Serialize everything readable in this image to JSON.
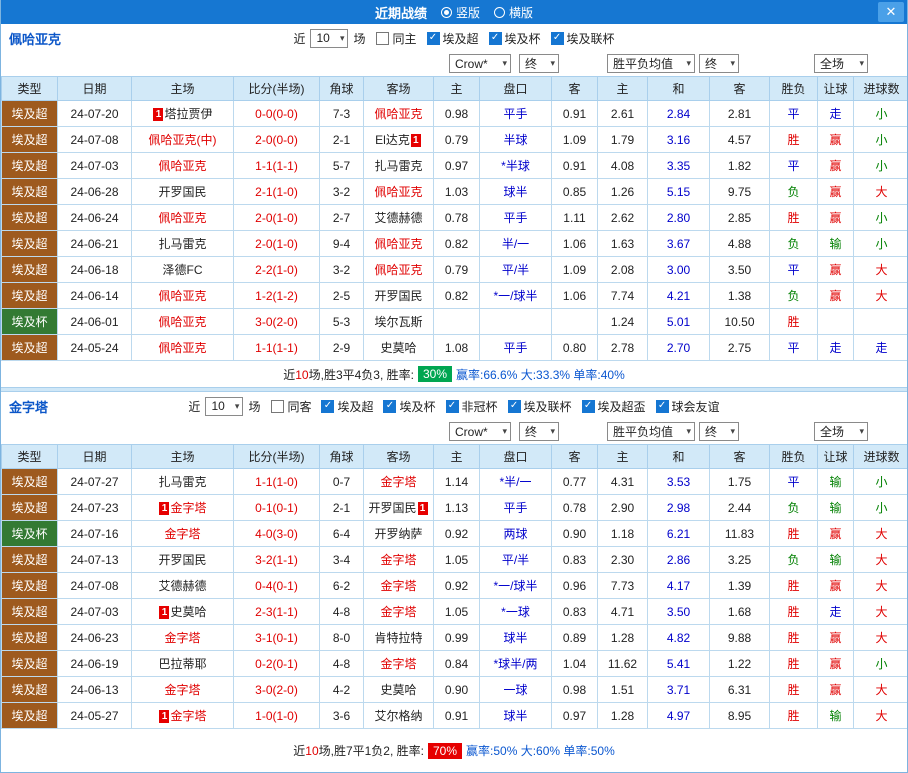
{
  "titlebar": {
    "title": "近期战绩",
    "radio_vertical": "竖版",
    "radio_horizontal": "横版"
  },
  "icons": {
    "close": "✕",
    "check": "✓",
    "dropdown": "▾"
  },
  "badge_char": "1",
  "columns": [
    "类型",
    "日期",
    "主场",
    "比分(半场)",
    "角球",
    "客场",
    "主",
    "盘口",
    "客",
    "主",
    "和",
    "客",
    "胜负",
    "让球",
    "进球数"
  ],
  "colors": {
    "titlebar_bg": "#1677d2",
    "super_bg": "#9e5a1e",
    "cup_bg": "#337a33",
    "red": "#e00000",
    "green": "#008000",
    "blue": "#0000cc",
    "rate_green_bg": "#00a651",
    "rate_red_bg": "#e60000",
    "value_map": {
      "胜": "red",
      "赢": "red",
      "大": "red",
      "负": "green",
      "输": "green",
      "小": "green",
      "平": "blue",
      "走": "blue"
    }
  },
  "section1": {
    "team": "佩哈亚克",
    "filters": {
      "near": "近",
      "count": "10",
      "games": "场",
      "checkboxes": [
        {
          "label": "同主",
          "checked": false
        },
        {
          "label": "埃及超",
          "checked": true
        },
        {
          "label": "埃及杯",
          "checked": true
        },
        {
          "label": "埃及联杯",
          "checked": true
        }
      ]
    },
    "selects": {
      "book": "Crow*",
      "t1": "终",
      "avg": "胜平负均值",
      "t2": "终",
      "scope": "全场"
    },
    "rows": [
      {
        "type": "埃及超",
        "league": "super",
        "date": "24-07-20",
        "home": "塔拉贾伊",
        "home_focal": false,
        "home_badge": "pre",
        "score": "0-0(0-0)",
        "corner": "7-3",
        "away": "佩哈亚克",
        "away_focal": true,
        "away_badge": "",
        "odds_h": "0.98",
        "handicap": "平手",
        "odds_a": "0.91",
        "eu_h": "2.61",
        "eu_d": "2.84",
        "eu_a": "2.81",
        "result": "平",
        "let_result": "走",
        "goal_result": "小"
      },
      {
        "type": "埃及超",
        "league": "super",
        "date": "24-07-08",
        "home": "佩哈亚克(中)",
        "home_focal": true,
        "home_badge": "",
        "score": "2-0(0-0)",
        "corner": "2-1",
        "away": "El达克",
        "away_focal": false,
        "away_badge": "post",
        "odds_h": "0.79",
        "handicap": "半球",
        "odds_a": "1.09",
        "eu_h": "1.79",
        "eu_d": "3.16",
        "eu_a": "4.57",
        "result": "胜",
        "let_result": "赢",
        "goal_result": "小"
      },
      {
        "type": "埃及超",
        "league": "super",
        "date": "24-07-03",
        "home": "佩哈亚克",
        "home_focal": true,
        "home_badge": "",
        "score": "1-1(1-1)",
        "corner": "5-7",
        "away": "扎马雷克",
        "away_focal": false,
        "away_badge": "",
        "odds_h": "0.97",
        "handicap": "*半球",
        "odds_a": "0.91",
        "eu_h": "4.08",
        "eu_d": "3.35",
        "eu_a": "1.82",
        "result": "平",
        "let_result": "赢",
        "goal_result": "小"
      },
      {
        "type": "埃及超",
        "league": "super",
        "date": "24-06-28",
        "home": "开罗国民",
        "home_focal": false,
        "home_badge": "",
        "score": "2-1(1-0)",
        "corner": "3-2",
        "away": "佩哈亚克",
        "away_focal": true,
        "away_badge": "",
        "odds_h": "1.03",
        "handicap": "球半",
        "odds_a": "0.85",
        "eu_h": "1.26",
        "eu_d": "5.15",
        "eu_a": "9.75",
        "result": "负",
        "let_result": "赢",
        "goal_result": "大"
      },
      {
        "type": "埃及超",
        "league": "super",
        "date": "24-06-24",
        "home": "佩哈亚克",
        "home_focal": true,
        "home_badge": "",
        "score": "2-0(1-0)",
        "corner": "2-7",
        "away": "艾德赫德",
        "away_focal": false,
        "away_badge": "",
        "odds_h": "0.78",
        "handicap": "平手",
        "odds_a": "1.11",
        "eu_h": "2.62",
        "eu_d": "2.80",
        "eu_a": "2.85",
        "result": "胜",
        "let_result": "赢",
        "goal_result": "小"
      },
      {
        "type": "埃及超",
        "league": "super",
        "date": "24-06-21",
        "home": "扎马雷克",
        "home_focal": false,
        "home_badge": "",
        "score": "2-0(1-0)",
        "corner": "9-4",
        "away": "佩哈亚克",
        "away_focal": true,
        "away_badge": "",
        "odds_h": "0.82",
        "handicap": "半/一",
        "odds_a": "1.06",
        "eu_h": "1.63",
        "eu_d": "3.67",
        "eu_a": "4.88",
        "result": "负",
        "let_result": "输",
        "goal_result": "小"
      },
      {
        "type": "埃及超",
        "league": "super",
        "date": "24-06-18",
        "home": "泽德FC",
        "home_focal": false,
        "home_badge": "",
        "score": "2-2(1-0)",
        "corner": "3-2",
        "away": "佩哈亚克",
        "away_focal": true,
        "away_badge": "",
        "odds_h": "0.79",
        "handicap": "平/半",
        "odds_a": "1.09",
        "eu_h": "2.08",
        "eu_d": "3.00",
        "eu_a": "3.50",
        "result": "平",
        "let_result": "赢",
        "goal_result": "大"
      },
      {
        "type": "埃及超",
        "league": "super",
        "date": "24-06-14",
        "home": "佩哈亚克",
        "home_focal": true,
        "home_badge": "",
        "score": "1-2(1-2)",
        "corner": "2-5",
        "away": "开罗国民",
        "away_focal": false,
        "away_badge": "",
        "odds_h": "0.82",
        "handicap": "*一/球半",
        "odds_a": "1.06",
        "eu_h": "7.74",
        "eu_d": "4.21",
        "eu_a": "1.38",
        "result": "负",
        "let_result": "赢",
        "goal_result": "大"
      },
      {
        "type": "埃及杯",
        "league": "cup",
        "date": "24-06-01",
        "home": "佩哈亚克",
        "home_focal": true,
        "home_badge": "",
        "score": "3-0(2-0)",
        "corner": "5-3",
        "away": "埃尔瓦斯",
        "away_focal": false,
        "away_badge": "",
        "odds_h": "",
        "handicap": "",
        "odds_a": "",
        "eu_h": "1.24",
        "eu_d": "5.01",
        "eu_a": "10.50",
        "result": "胜",
        "let_result": "",
        "goal_result": ""
      },
      {
        "type": "埃及超",
        "league": "super",
        "date": "24-05-24",
        "home": "佩哈亚克",
        "home_focal": true,
        "home_badge": "",
        "score": "1-1(1-1)",
        "corner": "2-9",
        "away": "史莫哈",
        "away_focal": false,
        "away_badge": "",
        "odds_h": "1.08",
        "handicap": "平手",
        "odds_a": "0.80",
        "eu_h": "2.78",
        "eu_d": "2.70",
        "eu_a": "2.75",
        "result": "平",
        "let_result": "走",
        "goal_result": "走"
      }
    ],
    "summary": {
      "prefix": "近",
      "count": "10",
      "middle": "场,胜3平4负3, 胜率:",
      "rate": "30%",
      "suffix": "赢率:66.6% 大:33.3% 单率:40%"
    }
  },
  "section2": {
    "team": "金字塔",
    "filters": {
      "near": "近",
      "count": "10",
      "games": "场",
      "checkboxes": [
        {
          "label": "同客",
          "checked": false
        },
        {
          "label": "埃及超",
          "checked": true
        },
        {
          "label": "埃及杯",
          "checked": true
        },
        {
          "label": "非冠杯",
          "checked": true
        },
        {
          "label": "埃及联杯",
          "checked": true
        },
        {
          "label": "埃及超盃",
          "checked": true
        },
        {
          "label": "球会友谊",
          "checked": true
        }
      ]
    },
    "selects": {
      "book": "Crow*",
      "t1": "终",
      "avg": "胜平负均值",
      "t2": "终",
      "scope": "全场"
    },
    "rows": [
      {
        "type": "埃及超",
        "league": "super",
        "date": "24-07-27",
        "home": "扎马雷克",
        "home_focal": false,
        "home_badge": "",
        "score": "1-1(1-0)",
        "corner": "0-7",
        "away": "金字塔",
        "away_focal": true,
        "away_badge": "",
        "odds_h": "1.14",
        "handicap": "*半/一",
        "odds_a": "0.77",
        "eu_h": "4.31",
        "eu_d": "3.53",
        "eu_a": "1.75",
        "result": "平",
        "let_result": "输",
        "goal_result": "小"
      },
      {
        "type": "埃及超",
        "league": "super",
        "date": "24-07-23",
        "home": "金字塔",
        "home_focal": true,
        "home_badge": "pre",
        "score": "0-1(0-1)",
        "corner": "2-1",
        "away": "开罗国民",
        "away_focal": false,
        "away_badge": "post",
        "odds_h": "1.13",
        "handicap": "平手",
        "odds_a": "0.78",
        "eu_h": "2.90",
        "eu_d": "2.98",
        "eu_a": "2.44",
        "result": "负",
        "let_result": "输",
        "goal_result": "小"
      },
      {
        "type": "埃及杯",
        "league": "cup",
        "date": "24-07-16",
        "home": "金字塔",
        "home_focal": true,
        "home_badge": "",
        "score": "4-0(3-0)",
        "corner": "6-4",
        "away": "开罗纳萨",
        "away_focal": false,
        "away_badge": "",
        "odds_h": "0.92",
        "handicap": "两球",
        "odds_a": "0.90",
        "eu_h": "1.18",
        "eu_d": "6.21",
        "eu_a": "11.83",
        "result": "胜",
        "let_result": "赢",
        "goal_result": "大"
      },
      {
        "type": "埃及超",
        "league": "super",
        "date": "24-07-13",
        "home": "开罗国民",
        "home_focal": false,
        "home_badge": "",
        "score": "3-2(1-1)",
        "corner": "3-4",
        "away": "金字塔",
        "away_focal": true,
        "away_badge": "",
        "odds_h": "1.05",
        "handicap": "平/半",
        "odds_a": "0.83",
        "eu_h": "2.30",
        "eu_d": "2.86",
        "eu_a": "3.25",
        "result": "负",
        "let_result": "输",
        "goal_result": "大"
      },
      {
        "type": "埃及超",
        "league": "super",
        "date": "24-07-08",
        "home": "艾德赫德",
        "home_focal": false,
        "home_badge": "",
        "score": "0-4(0-1)",
        "corner": "6-2",
        "away": "金字塔",
        "away_focal": true,
        "away_badge": "",
        "odds_h": "0.92",
        "handicap": "*一/球半",
        "odds_a": "0.96",
        "eu_h": "7.73",
        "eu_d": "4.17",
        "eu_a": "1.39",
        "result": "胜",
        "let_result": "赢",
        "goal_result": "大"
      },
      {
        "type": "埃及超",
        "league": "super",
        "date": "24-07-03",
        "home": "史莫哈",
        "home_focal": false,
        "home_badge": "pre",
        "score": "2-3(1-1)",
        "corner": "4-8",
        "away": "金字塔",
        "away_focal": true,
        "away_badge": "",
        "odds_h": "1.05",
        "handicap": "*一球",
        "odds_a": "0.83",
        "eu_h": "4.71",
        "eu_d": "3.50",
        "eu_a": "1.68",
        "result": "胜",
        "let_result": "走",
        "goal_result": "大"
      },
      {
        "type": "埃及超",
        "league": "super",
        "date": "24-06-23",
        "home": "金字塔",
        "home_focal": true,
        "home_badge": "",
        "score": "3-1(0-1)",
        "corner": "8-0",
        "away": "肯特拉特",
        "away_focal": false,
        "away_badge": "",
        "odds_h": "0.99",
        "handicap": "球半",
        "odds_a": "0.89",
        "eu_h": "1.28",
        "eu_d": "4.82",
        "eu_a": "9.88",
        "result": "胜",
        "let_result": "赢",
        "goal_result": "大"
      },
      {
        "type": "埃及超",
        "league": "super",
        "date": "24-06-19",
        "home": "巴拉蒂耶",
        "home_focal": false,
        "home_badge": "",
        "score": "0-2(0-1)",
        "corner": "4-8",
        "away": "金字塔",
        "away_focal": true,
        "away_badge": "",
        "odds_h": "0.84",
        "handicap": "*球半/两",
        "odds_a": "1.04",
        "eu_h": "11.62",
        "eu_d": "5.41",
        "eu_a": "1.22",
        "result": "胜",
        "let_result": "赢",
        "goal_result": "小"
      },
      {
        "type": "埃及超",
        "league": "super",
        "date": "24-06-13",
        "home": "金字塔",
        "home_focal": true,
        "home_badge": "",
        "score": "3-0(2-0)",
        "corner": "4-2",
        "away": "史莫哈",
        "away_focal": false,
        "away_badge": "",
        "odds_h": "0.90",
        "handicap": "一球",
        "odds_a": "0.98",
        "eu_h": "1.51",
        "eu_d": "3.71",
        "eu_a": "6.31",
        "result": "胜",
        "let_result": "赢",
        "goal_result": "大"
      },
      {
        "type": "埃及超",
        "league": "super",
        "date": "24-05-27",
        "home": "金字塔",
        "home_focal": true,
        "home_badge": "pre",
        "score": "1-0(1-0)",
        "corner": "3-6",
        "away": "艾尔格纳",
        "away_focal": false,
        "away_badge": "",
        "odds_h": "0.91",
        "handicap": "球半",
        "odds_a": "0.97",
        "eu_h": "1.28",
        "eu_d": "4.97",
        "eu_a": "8.95",
        "result": "胜",
        "let_result": "输",
        "goal_result": "大"
      }
    ],
    "summary": {
      "prefix": "近",
      "count": "10",
      "middle": "场,胜7平1负2, 胜率:",
      "rate": "70%",
      "suffix": "赢率:50% 大:60% 单率:50%"
    }
  }
}
